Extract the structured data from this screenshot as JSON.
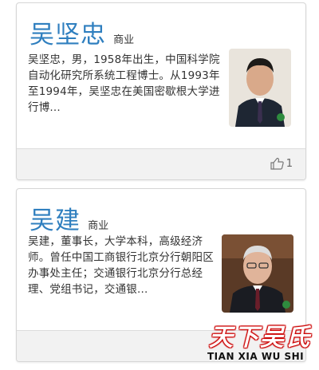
{
  "cards": [
    {
      "name": "吴坚忠",
      "tag": "商业",
      "description": "吴坚忠，男，1958年出生，中国科学院自动化研究所系统工程博士。从1993年至1994年，吴坚忠在美国密歇根大学进行博...",
      "like_count": "1",
      "photo_icon": "person-portrait"
    },
    {
      "name": "吴建",
      "tag": "商业",
      "description": "吴建，董事长，大学本科，高级经济师。曾任中国工商银行北京分行朝阳区办事处主任；交通银行北京分行总经理、党组书记，交通银...",
      "like_count": "",
      "photo_icon": "person-portrait"
    }
  ],
  "watermark": {
    "text_cn": "天下吴氏",
    "text_en": "TIAN XIA WU SHI"
  },
  "colors": {
    "name": "#2f7fbf",
    "footer": "#f2f2f2",
    "watermark_outline": "#cc0000"
  }
}
